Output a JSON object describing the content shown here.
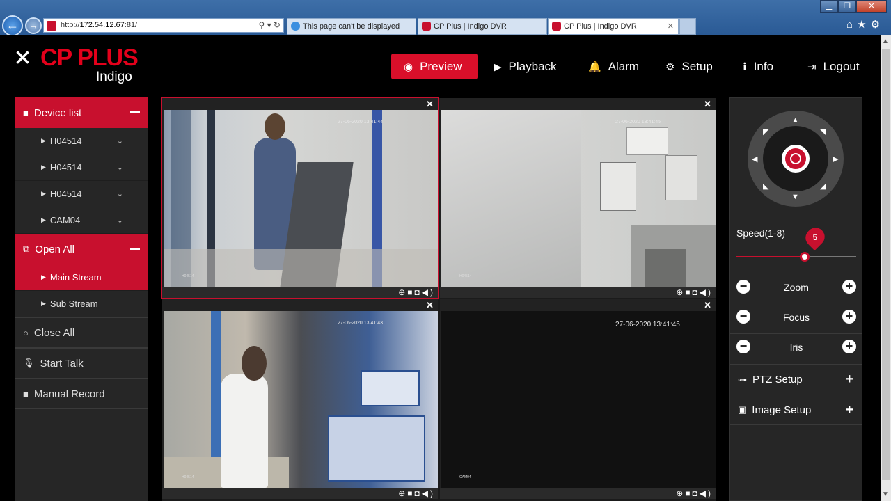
{
  "browser": {
    "url_prefix": "http://",
    "url_host": "172.54.12.67",
    "url_suffix": ":81/",
    "tabs": [
      {
        "label": "This page can't be displayed"
      },
      {
        "label": "CP Plus | Indigo DVR"
      },
      {
        "label": "CP Plus | Indigo DVR"
      }
    ]
  },
  "logo": {
    "brand": "CP PLUS",
    "product": "Indigo"
  },
  "nav": [
    {
      "label": "Preview",
      "icon": "eye-icon"
    },
    {
      "label": "Playback",
      "icon": "play-circle-icon"
    },
    {
      "label": "Alarm",
      "icon": "bell-icon"
    },
    {
      "label": "Setup",
      "icon": "gear-icon"
    },
    {
      "label": "Info",
      "icon": "info-circle-icon"
    },
    {
      "label": "Logout",
      "icon": "logout-icon"
    }
  ],
  "sidebar": {
    "device_list": "Device list",
    "devices": [
      "H04514",
      "H04514",
      "H04514",
      "CAM04"
    ],
    "open_all": "Open All",
    "streams": [
      "Main Stream",
      "Sub Stream"
    ],
    "close_all": "Close All",
    "start_talk": "Start Talk",
    "manual_record": "Manual Record"
  },
  "cameras": [
    {
      "timestamp": "27-06-2020 13:41:44",
      "label": "H04514"
    },
    {
      "timestamp": "27-06-2020 13:41:45",
      "label": "H04514"
    },
    {
      "timestamp": "27-06-2020 13:41:43",
      "label": "H04514"
    },
    {
      "timestamp": "27-06-2020 13:41:45",
      "label": "CAM04"
    }
  ],
  "ptz": {
    "speed_label": "Speed(1-8)",
    "speed_value": "5",
    "speed_fraction": 0.57,
    "zoom": "Zoom",
    "focus": "Focus",
    "iris": "Iris",
    "ptz_setup": "PTZ Setup",
    "image_setup": "Image Setup"
  },
  "colors": {
    "accent": "#c8102e",
    "panel": "#262626"
  }
}
